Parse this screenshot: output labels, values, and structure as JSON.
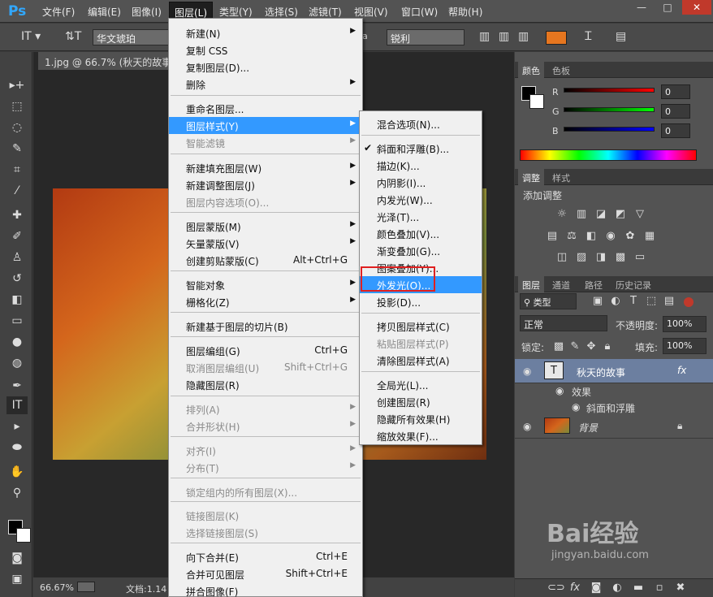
{
  "app": {
    "logo": "Ps"
  },
  "menubar": {
    "items": [
      "文件(F)",
      "编辑(E)",
      "图像(I)",
      "图层(L)",
      "类型(Y)",
      "选择(S)",
      "滤镜(T)",
      "视图(V)",
      "窗口(W)",
      "帮助(H)"
    ],
    "window_buttons": [
      "—",
      "□",
      "✕"
    ]
  },
  "options": {
    "font_family": "华文琥珀",
    "aa_prefix": "a",
    "aa_label": "锐利",
    "text_color": "#e6761f"
  },
  "document": {
    "tab_title": "1.jpg @ 66.7% (秋天的故事 ,",
    "zoom": "66.67%",
    "doc_info": "文档:1.14"
  },
  "color_panel": {
    "tabs": [
      "颜色",
      "色板"
    ],
    "r_label": "R",
    "g_label": "G",
    "b_label": "B",
    "r_value": "0",
    "g_value": "0",
    "b_value": "0"
  },
  "adjust_panel": {
    "tabs": [
      "调整",
      "样式"
    ],
    "title": "添加调整"
  },
  "layers_panel": {
    "tabs": [
      "图层",
      "通道",
      "路径",
      "历史记录"
    ],
    "filter_kind": "类型",
    "blend_mode": "正常",
    "opacity_label": "不透明度:",
    "opacity_value": "100%",
    "lock_label": "锁定:",
    "fill_label": "填充:",
    "fill_value": "100%",
    "layers": [
      {
        "name": "秋天的故事",
        "fx": "fx",
        "thumb": "T"
      },
      {
        "name": "效果"
      },
      {
        "name": "斜面和浮雕"
      },
      {
        "name": "背景"
      }
    ]
  },
  "layer_menu": {
    "items": [
      {
        "label": "新建(N)",
        "shortcut": "",
        "arrow": true,
        "disabled": false
      },
      {
        "label": "复制 CSS",
        "shortcut": "",
        "arrow": false,
        "disabled": false
      },
      {
        "label": "复制图层(D)...",
        "shortcut": "",
        "arrow": false,
        "disabled": false
      },
      {
        "label": "删除",
        "shortcut": "",
        "arrow": true,
        "disabled": false
      },
      {
        "label": "重命名图层...",
        "shortcut": "",
        "arrow": false,
        "disabled": false
      },
      {
        "label": "图层样式(Y)",
        "shortcut": "",
        "arrow": true,
        "disabled": false
      },
      {
        "label": "智能滤镜",
        "shortcut": "",
        "arrow": true,
        "disabled": true
      },
      {
        "label": "新建填充图层(W)",
        "shortcut": "",
        "arrow": true,
        "disabled": false
      },
      {
        "label": "新建调整图层(J)",
        "shortcut": "",
        "arrow": true,
        "disabled": false
      },
      {
        "label": "图层内容选项(O)...",
        "shortcut": "",
        "arrow": false,
        "disabled": true
      },
      {
        "label": "图层蒙版(M)",
        "shortcut": "",
        "arrow": true,
        "disabled": false
      },
      {
        "label": "矢量蒙版(V)",
        "shortcut": "",
        "arrow": true,
        "disabled": false
      },
      {
        "label": "创建剪贴蒙版(C)",
        "shortcut": "Alt+Ctrl+G",
        "arrow": false,
        "disabled": false
      },
      {
        "label": "智能对象",
        "shortcut": "",
        "arrow": true,
        "disabled": false
      },
      {
        "label": "栅格化(Z)",
        "shortcut": "",
        "arrow": true,
        "disabled": false
      },
      {
        "label": "新建基于图层的切片(B)",
        "shortcut": "",
        "arrow": false,
        "disabled": false
      },
      {
        "label": "图层编组(G)",
        "shortcut": "Ctrl+G",
        "arrow": false,
        "disabled": false
      },
      {
        "label": "取消图层编组(U)",
        "shortcut": "Shift+Ctrl+G",
        "arrow": false,
        "disabled": true
      },
      {
        "label": "隐藏图层(R)",
        "shortcut": "",
        "arrow": false,
        "disabled": false
      },
      {
        "label": "排列(A)",
        "shortcut": "",
        "arrow": true,
        "disabled": true
      },
      {
        "label": "合并形状(H)",
        "shortcut": "",
        "arrow": true,
        "disabled": true
      },
      {
        "label": "对齐(I)",
        "shortcut": "",
        "arrow": true,
        "disabled": true
      },
      {
        "label": "分布(T)",
        "shortcut": "",
        "arrow": true,
        "disabled": true
      },
      {
        "label": "锁定组内的所有图层(X)...",
        "shortcut": "",
        "arrow": false,
        "disabled": true
      },
      {
        "label": "链接图层(K)",
        "shortcut": "",
        "arrow": false,
        "disabled": true
      },
      {
        "label": "选择链接图层(S)",
        "shortcut": "",
        "arrow": false,
        "disabled": true
      },
      {
        "label": "向下合并(E)",
        "shortcut": "Ctrl+E",
        "arrow": false,
        "disabled": false
      },
      {
        "label": "合并可见图层",
        "shortcut": "Shift+Ctrl+E",
        "arrow": false,
        "disabled": false
      },
      {
        "label": "拼合图像(F)",
        "shortcut": "",
        "arrow": false,
        "disabled": false
      }
    ]
  },
  "style_submenu": {
    "items": [
      {
        "label": "混合选项(N)...",
        "check": false,
        "disabled": false
      },
      {
        "label": "斜面和浮雕(B)...",
        "check": true,
        "disabled": false
      },
      {
        "label": "描边(K)...",
        "check": false,
        "disabled": false
      },
      {
        "label": "内阴影(I)...",
        "check": false,
        "disabled": false
      },
      {
        "label": "内发光(W)...",
        "check": false,
        "disabled": false
      },
      {
        "label": "光泽(T)...",
        "check": false,
        "disabled": false
      },
      {
        "label": "颜色叠加(V)...",
        "check": false,
        "disabled": false
      },
      {
        "label": "渐变叠加(G)...",
        "check": false,
        "disabled": false
      },
      {
        "label": "图案叠加(Y)...",
        "check": false,
        "disabled": false
      },
      {
        "label": "外发光(O)...",
        "check": false,
        "disabled": false
      },
      {
        "label": "投影(D)...",
        "check": false,
        "disabled": false
      },
      {
        "label": "拷贝图层样式(C)",
        "check": false,
        "disabled": false
      },
      {
        "label": "粘贴图层样式(P)",
        "check": false,
        "disabled": true
      },
      {
        "label": "清除图层样式(A)",
        "check": false,
        "disabled": false
      },
      {
        "label": "全局光(L)...",
        "check": false,
        "disabled": false
      },
      {
        "label": "创建图层(R)",
        "check": false,
        "disabled": false
      },
      {
        "label": "隐藏所有效果(H)",
        "check": false,
        "disabled": false
      },
      {
        "label": "缩放效果(F)...",
        "check": false,
        "disabled": false
      }
    ]
  },
  "watermark": {
    "text": "Bai经验",
    "url": "jingyan.baidu.com"
  }
}
